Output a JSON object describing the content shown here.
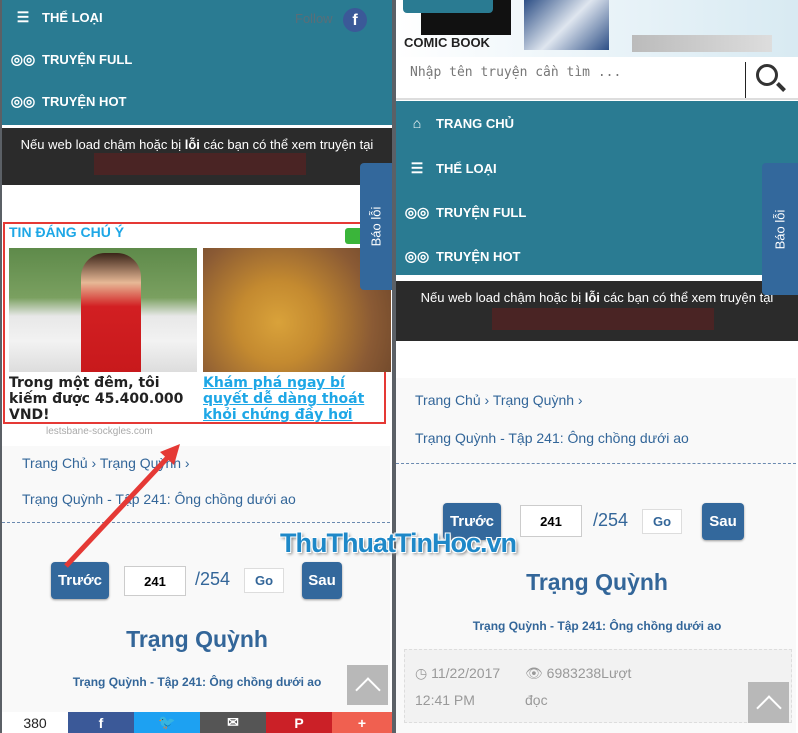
{
  "left": {
    "nav": [
      {
        "icon": "list-icon",
        "label": "THỂ LOẠI"
      },
      {
        "icon": "glasses-icon",
        "label": "TRUYỆN FULL"
      },
      {
        "icon": "glasses-icon",
        "label": "TRUYỆN HOT"
      }
    ],
    "follow": "Follow",
    "notice": {
      "text_a": "Nếu web load chậm hoặc bị ",
      "text_bold": "lỗi",
      "text_b": " các bạn có thể xem truyện tại"
    },
    "report_tab": "Báo lỗi",
    "ad": {
      "heading": "TIN ĐÁNG CHÚ Ý",
      "items": [
        {
          "caption": "Trong một đêm, tôi kiếm được 45.400.000 VND!"
        },
        {
          "caption": "Khám phá ngay bí quyết dễ dàng thoát khỏi chứng đầy hơi"
        }
      ],
      "source": "lestsbane-sockgles.com"
    },
    "breadcrumb": {
      "home": "Trang Chủ",
      "series": "Trạng Quỳnh",
      "chapter": "Trạng Quỳnh - Tập 241: Ông chồng dưới ao"
    },
    "pager": {
      "prev": "Trước",
      "page": "241",
      "total": "/254",
      "go": "Go",
      "next": "Sau"
    },
    "title": "Trạng Quỳnh",
    "subtitle": "Trạng Quỳnh - Tập 241: Ông chồng dưới ao",
    "share": {
      "count": "380",
      "buttons": [
        {
          "icon": "facebook-icon",
          "glyph": "f",
          "color": "#3b5998"
        },
        {
          "icon": "twitter-icon",
          "glyph": "🐦",
          "color": "#1da1f2"
        },
        {
          "icon": "email-icon",
          "glyph": "✉",
          "color": "#555555"
        },
        {
          "icon": "pinterest-icon",
          "glyph": "P",
          "color": "#cb2027"
        },
        {
          "icon": "more-icon",
          "glyph": "+",
          "color": "#f06050"
        }
      ]
    }
  },
  "right": {
    "logo": "COMIC BOOK",
    "search_placeholder": "Nhập tên truyện cần tìm ...",
    "nav": [
      {
        "icon": "home-icon",
        "label": "TRANG CHỦ"
      },
      {
        "icon": "list-icon",
        "label": "THỂ LOẠI"
      },
      {
        "icon": "glasses-icon",
        "label": "TRUYỆN FULL"
      },
      {
        "icon": "glasses-icon",
        "label": "TRUYỆN HOT"
      }
    ],
    "notice": {
      "text_a": "Nếu web load chậm hoặc bị ",
      "text_bold": "lỗi",
      "text_b": " các bạn có thể xem truyện tại"
    },
    "report_tab": "Báo lỗi",
    "breadcrumb": {
      "home": "Trang Chủ",
      "series": "Trạng Quỳnh",
      "chapter": "Trạng Quỳnh - Tập 241: Ông chồng dưới ao"
    },
    "pager": {
      "prev": "Trước",
      "page": "241",
      "total": "/254",
      "go": "Go",
      "next": "Sau"
    },
    "title": "Trạng Quỳnh",
    "subtitle": "Trạng Quỳnh - Tập 241: Ông chồng dưới ao",
    "info": {
      "date": "11/22/2017",
      "time": "12:41 PM",
      "views": "6983238Lượt",
      "views_suffix": "đọc"
    }
  },
  "watermark": "ThuThuatTinHoc.vn",
  "colors": {
    "nav": "#2a7b92",
    "button": "#33689c",
    "highlight": "#e53935"
  }
}
